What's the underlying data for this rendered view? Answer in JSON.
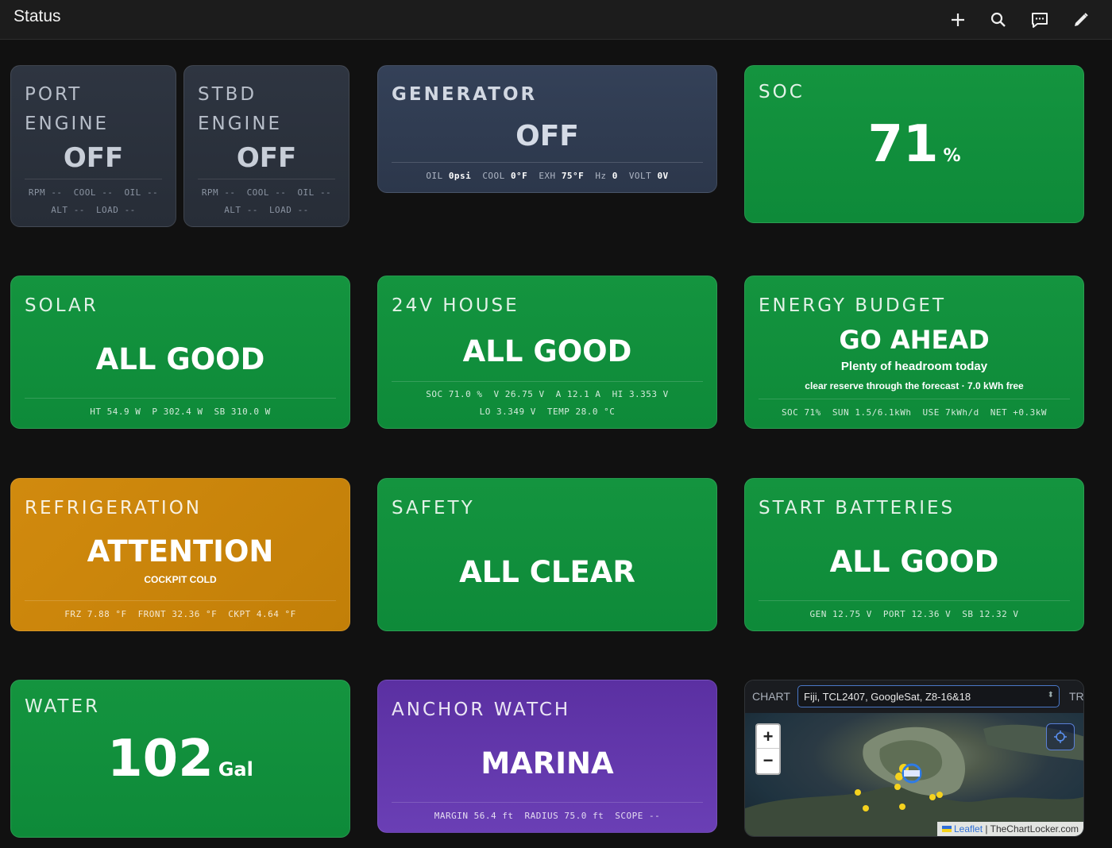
{
  "header": {
    "title": "Status",
    "actions": [
      {
        "name": "add",
        "icon": "plus-icon"
      },
      {
        "name": "search",
        "icon": "search-icon"
      },
      {
        "name": "chat",
        "icon": "chat-icon"
      },
      {
        "name": "edit",
        "icon": "pencil-icon"
      }
    ]
  },
  "port_engine": {
    "label_line1": "PORT",
    "label_line2": "ENGINE",
    "status": "OFF",
    "stats_row1": [
      {
        "k": "RPM",
        "v": "--"
      },
      {
        "k": "COOL",
        "v": "--"
      },
      {
        "k": "OIL",
        "v": "--"
      }
    ],
    "stats_row2": [
      {
        "k": "ALT",
        "v": "--"
      },
      {
        "k": "LOAD",
        "v": "--"
      }
    ]
  },
  "stbd_engine": {
    "label_line1": "STBD",
    "label_line2": "ENGINE",
    "status": "OFF",
    "stats_row1": [
      {
        "k": "RPM",
        "v": "--"
      },
      {
        "k": "COOL",
        "v": "--"
      },
      {
        "k": "OIL",
        "v": "--"
      }
    ],
    "stats_row2": [
      {
        "k": "ALT",
        "v": "--"
      },
      {
        "k": "LOAD",
        "v": "--"
      }
    ]
  },
  "generator": {
    "label": "GENERATOR",
    "status": "OFF",
    "stats": [
      {
        "k": "OIL",
        "v": "0psi"
      },
      {
        "k": "COOL",
        "v": "0°F"
      },
      {
        "k": "EXH",
        "v": "75°F"
      },
      {
        "k": "Hz",
        "v": "0"
      },
      {
        "k": "VOLT",
        "v": "0V"
      }
    ]
  },
  "soc": {
    "label": "SOC",
    "value": "71",
    "unit": "%"
  },
  "solar": {
    "label": "SOLAR",
    "status": "ALL GOOD",
    "stats": [
      {
        "k": "HT",
        "v": "54.9 W"
      },
      {
        "k": "P",
        "v": "302.4 W"
      },
      {
        "k": "SB",
        "v": "310.0 W"
      }
    ]
  },
  "house": {
    "label": "24V HOUSE",
    "status": "ALL GOOD",
    "stats_row1": [
      {
        "k": "SOC",
        "v": "71.0 %"
      },
      {
        "k": "V",
        "v": "26.75 V"
      },
      {
        "k": "A",
        "v": "12.1 A"
      },
      {
        "k": "HI",
        "v": "3.353 V"
      }
    ],
    "stats_row2": [
      {
        "k": "LO",
        "v": "3.349 V"
      },
      {
        "k": "TEMP",
        "v": "28.0 °C"
      }
    ]
  },
  "energy_budget": {
    "label": "ENERGY BUDGET",
    "status": "GO AHEAD",
    "headline": "Plenty of headroom today",
    "detail": "clear reserve through the forecast · 7.0 kWh free",
    "stats": [
      {
        "k": "SOC",
        "v": "71%"
      },
      {
        "k": "SUN",
        "v": "1.5/6.1kWh"
      },
      {
        "k": "USE",
        "v": "7kWh/d"
      },
      {
        "k": "NET",
        "v": "+0.3kW"
      }
    ]
  },
  "refrigeration": {
    "label": "REFRIGERATION",
    "status": "ATTENTION",
    "note": "COCKPIT COLD",
    "stats": [
      {
        "k": "FRZ",
        "v": "7.88 °F"
      },
      {
        "k": "FRONT",
        "v": "32.36 °F"
      },
      {
        "k": "CKPT",
        "v": "4.64 °F"
      }
    ]
  },
  "safety": {
    "label": "SAFETY",
    "status": "ALL CLEAR"
  },
  "start_batteries": {
    "label": "START BATTERIES",
    "status": "ALL GOOD",
    "stats": [
      {
        "k": "GEN",
        "v": "12.75 V"
      },
      {
        "k": "PORT",
        "v": "12.36 V"
      },
      {
        "k": "SB",
        "v": "12.32 V"
      }
    ]
  },
  "water": {
    "label": "WATER",
    "value": "102",
    "unit": "Gal"
  },
  "anchor_watch": {
    "label": "ANCHOR WATCH",
    "status": "MARINA",
    "stats": [
      {
        "k": "MARGIN",
        "v": "56.4 ft"
      },
      {
        "k": "RADIUS",
        "v": "75.0 ft"
      },
      {
        "k": "SCOPE",
        "v": "--"
      }
    ]
  },
  "map": {
    "chart_label": "CHART",
    "chart_selected": "Fiji, TCL2407, GoogleSat, Z8-16&18",
    "track_label": "TR",
    "zoom_in": "+",
    "zoom_out": "−",
    "attribution_link": "Leaflet",
    "attribution_sep": " | ",
    "attribution_source": "TheChartLocker.com"
  },
  "colors": {
    "good": "#12913e",
    "neutral": "#2b313c",
    "generator": "#313d52",
    "attention": "#c98409",
    "anchor": "#6138ab",
    "background": "#111111"
  }
}
